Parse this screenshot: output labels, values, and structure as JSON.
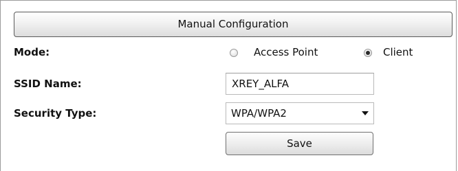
{
  "header": {
    "title": "Manual Configuration"
  },
  "mode": {
    "label": "Mode:",
    "options": [
      {
        "label": "Access Point",
        "selected": false
      },
      {
        "label": "Client",
        "selected": true
      }
    ]
  },
  "ssid": {
    "label": "SSID Name:",
    "value": "XREY_ALFA"
  },
  "security": {
    "label": "Security Type:",
    "selected": "WPA/WPA2"
  },
  "actions": {
    "save_label": "Save"
  },
  "colors": {
    "border": "#9a9a9a",
    "button_border": "#5a5a5a",
    "text": "#111111"
  }
}
